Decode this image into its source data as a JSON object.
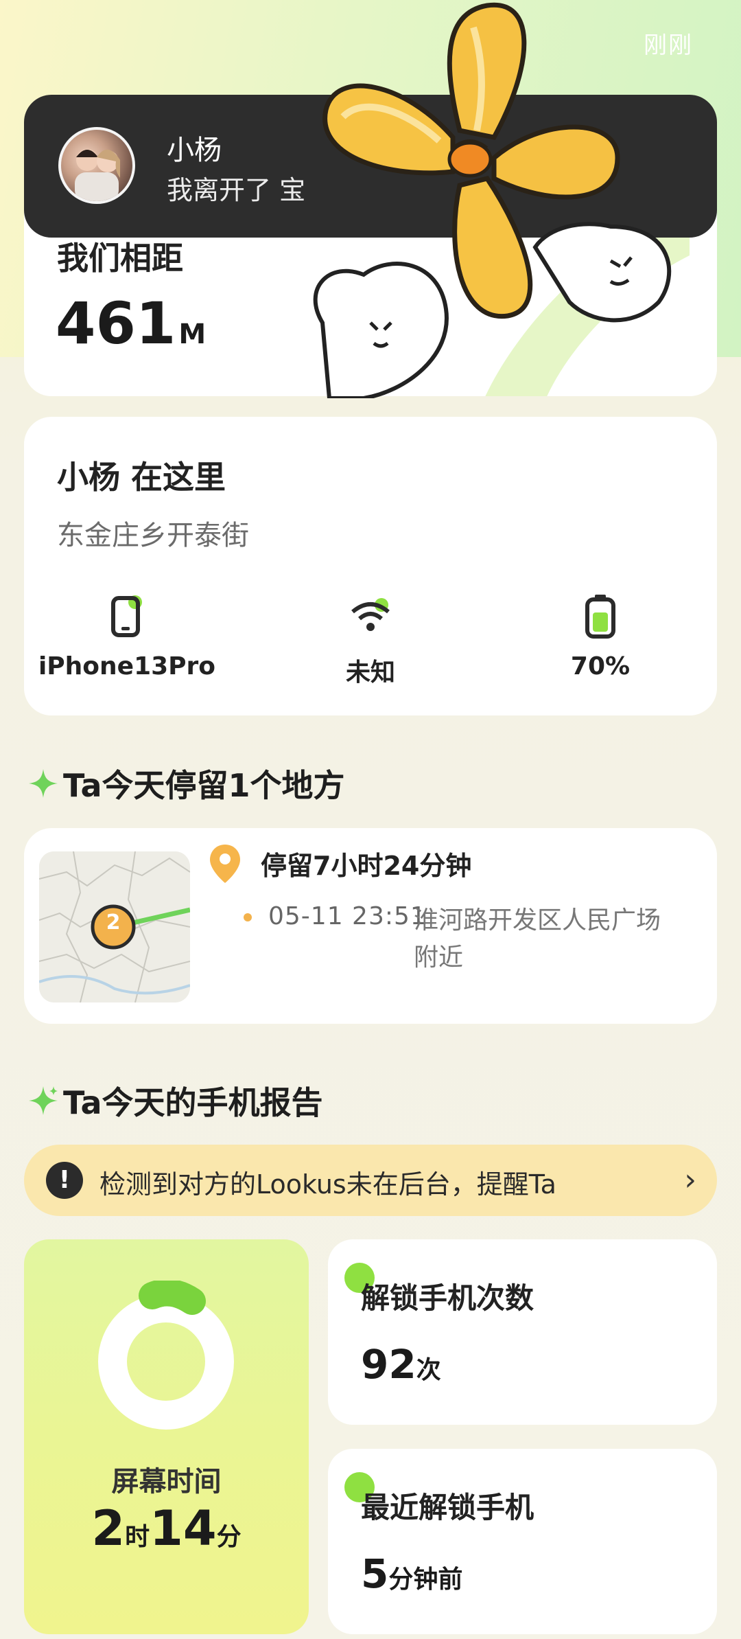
{
  "header": {
    "time_ago": "刚刚"
  },
  "notification": {
    "name": "小杨",
    "message": "我离开了 宝"
  },
  "distance": {
    "label": "我们相距",
    "value": "461",
    "unit": "M"
  },
  "location": {
    "title": "小杨 在这里",
    "address": "东金庄乡开泰街",
    "device": "iPhone13Pro",
    "wifi": "未知",
    "battery": "70%",
    "battery_level": 0.7
  },
  "stay_section": {
    "title": "Ta今天停留1个地方"
  },
  "stay": {
    "marker_number": "2",
    "duration": "停留7小时24分钟",
    "time": "05-11 23:51",
    "place": "淮河路开发区人民广场 附近"
  },
  "report_section": {
    "title": "Ta今天的手机报告"
  },
  "alert": {
    "text": "检测到对方的Lookus未在后台，提醒Ta",
    "arrow": "›"
  },
  "screen_time": {
    "label": "屏幕时间",
    "hours": "2",
    "hours_unit": "时",
    "minutes": "14",
    "minutes_unit": "分"
  },
  "unlock_count": {
    "title": "解锁手机次数",
    "value": "92",
    "unit": "次"
  },
  "last_unlock": {
    "title": "最近解锁手机",
    "value": "5",
    "unit": "分钟前"
  },
  "colors": {
    "accent_green": "#8fe041",
    "alert_bg": "#fae7ad",
    "dark_banner": "#2d2d2d"
  }
}
